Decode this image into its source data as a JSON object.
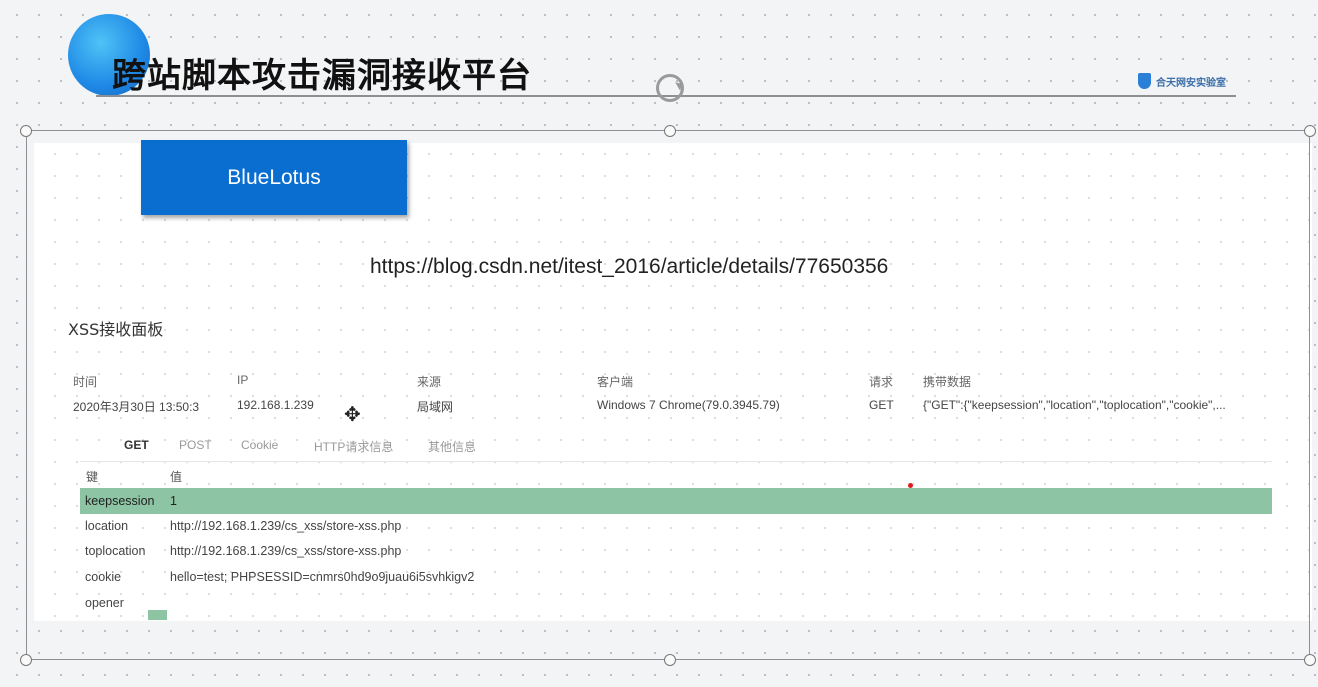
{
  "slide": {
    "title": "跨站脚本攻击漏洞接收平台",
    "brand_text": "合天网安实验室"
  },
  "button": {
    "label": "BlueLotus"
  },
  "article": {
    "url": "https://blog.csdn.net/itest_2016/article/details/77650356"
  },
  "panel": {
    "heading": "XSS接收面板"
  },
  "table": {
    "headers": [
      "时间",
      "IP",
      "来源",
      "客户端",
      "请求",
      "携带数据"
    ],
    "row": [
      "2020年3月30日 13:50:3",
      "192.168.1.239",
      "局域网",
      "Windows 7 Chrome(79.0.3945.79)",
      "GET",
      "{\"GET\":{\"keepsession\",\"location\",\"toplocation\",\"cookie\",..."
    ]
  },
  "tabs": [
    "GET",
    "POST",
    "Cookie",
    "HTTP请求信息",
    "其他信息"
  ],
  "kv": {
    "key_header": "键",
    "value_header": "值",
    "rows": [
      {
        "key": "keepsession",
        "value": "1"
      },
      {
        "key": "location",
        "value": "http://192.168.1.239/cs_xss/store-xss.php"
      },
      {
        "key": "toplocation",
        "value": "http://192.168.1.239/cs_xss/store-xss.php"
      },
      {
        "key": "cookie",
        "value": "hello=test; PHPSESSID=cnmrs0hd9o9juau6i5svhkigv2"
      },
      {
        "key": "opener",
        "value": ""
      }
    ]
  },
  "colors": {
    "accent_blue": "#0a6ed1",
    "highlight_green": "#8cc4a4"
  }
}
